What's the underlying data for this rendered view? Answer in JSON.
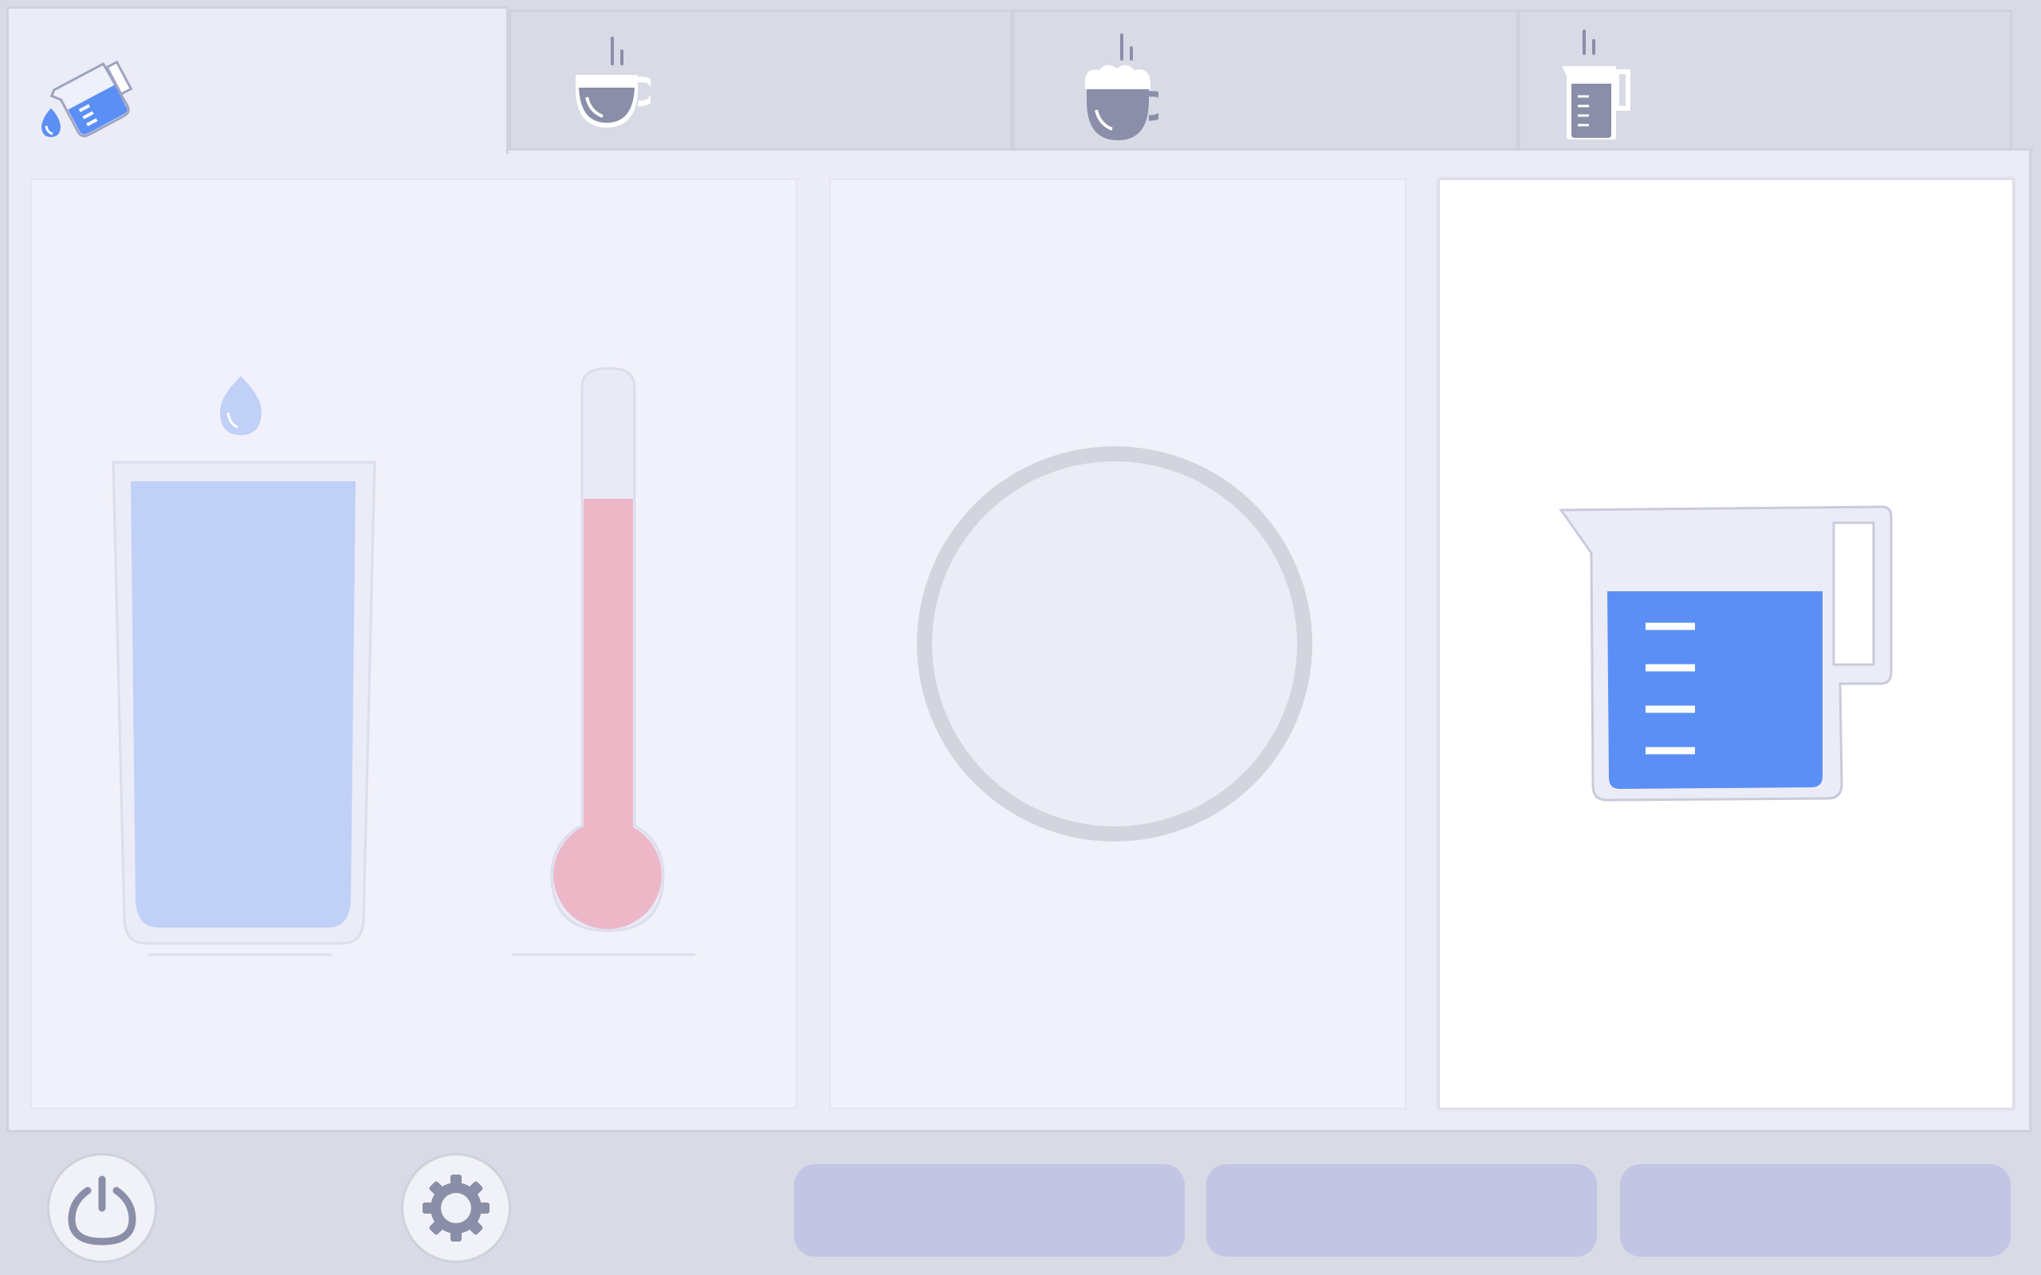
{
  "tabs": [
    {
      "icon": "measuring-jug-pour-icon",
      "active": true
    },
    {
      "icon": "espresso-cup-icon",
      "active": false
    },
    {
      "icon": "cappuccino-cup-icon",
      "active": false
    },
    {
      "icon": "jug-icon",
      "active": false
    }
  ],
  "panels": {
    "water": {
      "icon": "water-glass-icon",
      "level": 0.93
    },
    "temperature": {
      "icon": "thermometer-icon",
      "level": 0.78
    },
    "dial": {
      "icon": "empty-dial-icon"
    },
    "volume": {
      "icon": "measuring-jug-icon",
      "level": 0.72
    }
  },
  "footer": {
    "power": {
      "icon": "power-icon"
    },
    "settings": {
      "icon": "gear-icon"
    },
    "actions": [
      {
        "label": ""
      },
      {
        "label": ""
      },
      {
        "label": ""
      }
    ]
  },
  "colors": {
    "water_light": "#c0d0f7",
    "water_blue": "#5b8ff5",
    "thermo_pink": "#ecb8c8",
    "icon_gray": "#8a8ea8",
    "pill": "#c2c5e3"
  }
}
